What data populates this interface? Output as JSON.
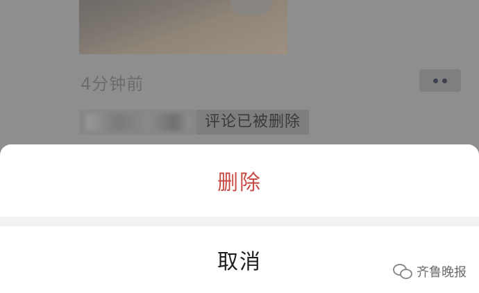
{
  "feed": {
    "timestamp": "4分钟前",
    "comment_status": "评论已被删除"
  },
  "action_sheet": {
    "delete_label": "删除",
    "cancel_label": "取消"
  },
  "watermark": {
    "text": "齐鲁晚报",
    "icon": "wechat-icon"
  },
  "colors": {
    "delete_text": "#c84a45",
    "cancel_text": "#1e1e1e",
    "overlay": "#8e8e8e"
  }
}
